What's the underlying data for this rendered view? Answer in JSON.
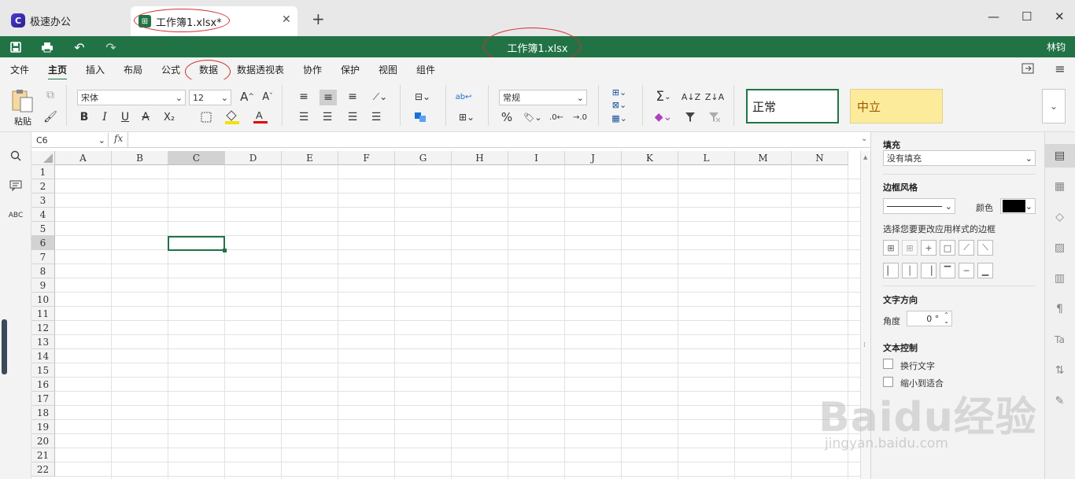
{
  "tabs": {
    "app_name": "极速办公",
    "app_logo_letter": "C",
    "doc_tab": "工作簿1.xlsx*",
    "close": "✕",
    "add": "+"
  },
  "window": {
    "minimize": "—",
    "maximize": "☐",
    "close": "✕"
  },
  "titlebar": {
    "doc_title": "工作簿1.xlsx",
    "user": "林钧"
  },
  "menu": {
    "items": [
      "文件",
      "主页",
      "插入",
      "布局",
      "公式",
      "数据",
      "数据透视表",
      "协作",
      "保护",
      "视图",
      "组件"
    ],
    "active": "主页"
  },
  "ribbon": {
    "paste_label": "粘贴",
    "font_name": "宋体",
    "font_size": "12",
    "number_format": "常规",
    "cell_styles": [
      "正常",
      "中立"
    ],
    "bold": "B",
    "italic": "I",
    "underline": "U",
    "strike": "A",
    "subscript": "X₂",
    "grow": "A",
    "shrink": "A",
    "percent": "%",
    "sum": "Σ"
  },
  "formula_bar": {
    "cell_ref": "C6",
    "fx": "fx",
    "value": ""
  },
  "grid": {
    "columns": [
      "A",
      "B",
      "C",
      "D",
      "E",
      "F",
      "G",
      "H",
      "I",
      "J",
      "K",
      "L",
      "M",
      "N"
    ],
    "rows": [
      "1",
      "2",
      "3",
      "4",
      "5",
      "6",
      "7",
      "8",
      "9",
      "10",
      "11",
      "12",
      "13",
      "14",
      "15",
      "16",
      "17",
      "18",
      "19",
      "20",
      "21",
      "22"
    ],
    "selected_col": "C",
    "selected_row": "6"
  },
  "right_panel": {
    "fill_label": "填充",
    "fill_value": "没有填充",
    "border_style_label": "边框风格",
    "color_label": "颜色",
    "border_hint": "选择您要更改应用样式的边框",
    "text_dir_label": "文字方向",
    "angle_label": "角度",
    "angle_value": "0 °",
    "text_control_label": "文本控制",
    "wrap_text": "换行文字",
    "merge_cells": "缩小到适合"
  },
  "watermark": {
    "brand": "Baidu经验",
    "url": "jingyan.baidu.com"
  },
  "colors": {
    "brand_green": "#217346",
    "neutral_fill": "#fdeb9c",
    "annotation": "#d03030"
  }
}
